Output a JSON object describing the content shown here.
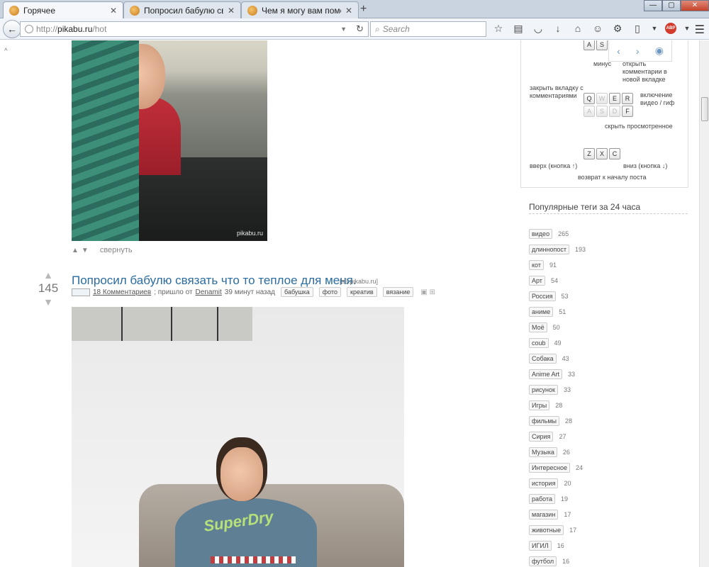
{
  "browser": {
    "tabs": [
      {
        "title": "Горячее"
      },
      {
        "title": "Попросил бабулю связат..."
      },
      {
        "title": "Чем я могу вам помочь?"
      }
    ],
    "url_scheme": "http://",
    "url_host": "pikabu.ru",
    "url_path": "/hot",
    "search_placeholder": "Search"
  },
  "post_above": {
    "watermark": "pikabu.ru",
    "collapse_label": "свернуть"
  },
  "post": {
    "rating": "145",
    "title": "Попросил бабулю связать что то теплое для меня.",
    "source": "[s5.pikabu.ru]",
    "comments": "18 Комментариев",
    "from_text": "; пришло от",
    "author": "Denamit",
    "time": "39 минут назад",
    "tags": [
      "бабушка",
      "фото",
      "креатив",
      "вязание"
    ],
    "shirt_logo": "SuperDry"
  },
  "hotkeys": {
    "keys_row1": [
      "A",
      "S"
    ],
    "keys_row2": [
      "Q",
      "W",
      "E",
      "R"
    ],
    "keys_row3": [
      "A",
      "S",
      "D",
      "F"
    ],
    "keys_row4": [
      "Z",
      "X",
      "C"
    ],
    "minus": "минус",
    "open_comments": "открыть комментарии в новой вкладке",
    "close_tab": "закрыть вкладку с комментариями",
    "enable_video": "включение видео / гиф",
    "hide_viewed": "скрыть просмотренное",
    "up": "вверх (кнопка ↑)",
    "down": "вниз (кнопка ↓)",
    "to_start": "возврат к началу поста"
  },
  "popular_tags": {
    "title": "Популярные теги за 24 часа",
    "items": [
      {
        "tag": "видео",
        "count": "265"
      },
      {
        "tag": "длиннопост",
        "count": "193"
      },
      {
        "tag": "кот",
        "count": "91"
      },
      {
        "tag": "Арт",
        "count": "54"
      },
      {
        "tag": "Россия",
        "count": "53"
      },
      {
        "tag": "аниме",
        "count": "51"
      },
      {
        "tag": "Моё",
        "count": "50"
      },
      {
        "tag": "coub",
        "count": "49"
      },
      {
        "tag": "Собака",
        "count": "43"
      },
      {
        "tag": "Anime Art",
        "count": "33"
      },
      {
        "tag": "рисунок",
        "count": "33"
      },
      {
        "tag": "Игры",
        "count": "28"
      },
      {
        "tag": "фильмы",
        "count": "28"
      },
      {
        "tag": "Сирия",
        "count": "27"
      },
      {
        "tag": "Музыка",
        "count": "26"
      },
      {
        "tag": "Интересное",
        "count": "24"
      },
      {
        "tag": "история",
        "count": "20"
      },
      {
        "tag": "работа",
        "count": "19"
      },
      {
        "tag": "магазин",
        "count": "17"
      },
      {
        "tag": "животные",
        "count": "17"
      },
      {
        "tag": "ИГИЛ",
        "count": "16"
      },
      {
        "tag": "футбол",
        "count": "16"
      }
    ]
  }
}
